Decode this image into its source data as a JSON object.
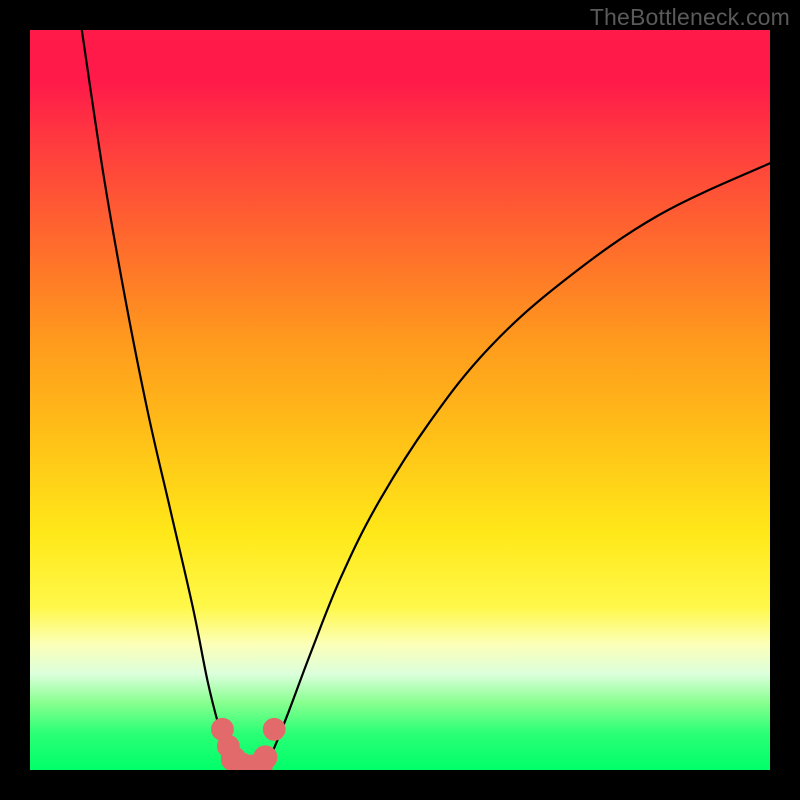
{
  "watermark": "TheBottleneck.com",
  "chart_data": {
    "type": "line",
    "title": "",
    "xlabel": "",
    "ylabel": "",
    "xlim": [
      0,
      100
    ],
    "ylim": [
      0,
      100
    ],
    "grid": false,
    "legend": false,
    "series": [
      {
        "name": "left-curve",
        "x": [
          7,
          10,
          13,
          16,
          19,
          22,
          24,
          25.5,
          26.5,
          27.3,
          28
        ],
        "values": [
          100,
          80,
          63,
          48,
          35,
          22,
          12,
          6,
          3,
          1,
          0
        ]
      },
      {
        "name": "right-curve",
        "x": [
          31.5,
          33,
          35,
          38,
          42,
          47,
          54,
          62,
          72,
          85,
          100
        ],
        "values": [
          0,
          3,
          8,
          16,
          26,
          36,
          47,
          57,
          66,
          75,
          82
        ]
      }
    ],
    "markers": {
      "name": "optimum-band",
      "color": "#e36a6a",
      "points": [
        {
          "x": 26.0,
          "y": 5.5,
          "r": 1.1
        },
        {
          "x": 26.8,
          "y": 3.2,
          "r": 1.1
        },
        {
          "x": 27.5,
          "y": 1.5,
          "r": 1.3
        },
        {
          "x": 28.5,
          "y": 0.5,
          "r": 1.5
        },
        {
          "x": 29.8,
          "y": 0.2,
          "r": 1.5
        },
        {
          "x": 31.0,
          "y": 0.5,
          "r": 1.4
        },
        {
          "x": 31.8,
          "y": 1.7,
          "r": 1.2
        },
        {
          "x": 33.0,
          "y": 5.5,
          "r": 1.1
        }
      ]
    },
    "background_gradient": {
      "top": "#ff1a4a",
      "mid": "#ffe819",
      "bottom": "#00ff69"
    }
  }
}
